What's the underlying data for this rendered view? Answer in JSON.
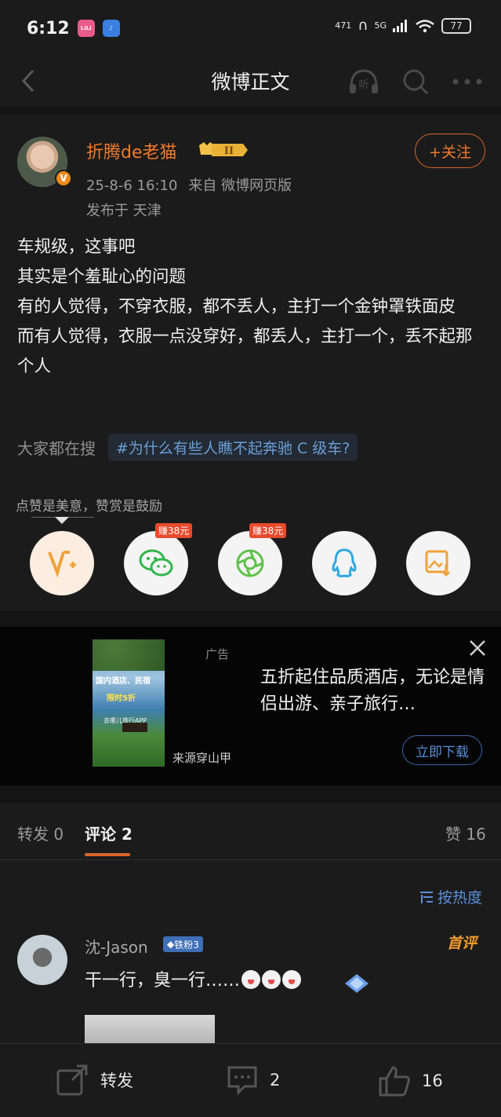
{
  "status_bar": {
    "time": "6:12",
    "app1": "LiLi",
    "net_speed": "471",
    "signal": "5G",
    "battery": "77"
  },
  "nav": {
    "title": "微博正文",
    "listen_label": "听"
  },
  "post": {
    "author": "折腾de老猫",
    "rank": "II",
    "follow_label": "+关注",
    "date": "25-8-6 16:10",
    "source": "来自 微博网页版",
    "location": "发布于 天津",
    "lines": [
      "车规级，这事吧",
      "其实是个羞耻心的问题",
      "有的人觉得，不穿衣服，都不丢人，主打一个金钟罩铁面皮",
      "而有人觉得，衣服一点没穿好，都丢人，主打一个，丢不起那个人"
    ],
    "search_label": "大家都在搜",
    "search_tag": "#为什么有些人瞧不起奔驰 C 级车?",
    "reward_caption": "点赞是美意，赞赏是鼓励",
    "earn_badge": "赚38元"
  },
  "ad": {
    "label": "广告",
    "image_title": "国内酒店、民宿",
    "image_subtitle": "限时5折",
    "image_caption": "去哪儿旅行APP",
    "text": "五折起住品质酒店，无论是情侣出游、亲子旅行…",
    "source": "来源穿山甲",
    "download_label": "立即下载"
  },
  "tabs": {
    "repost": "转发 0",
    "comment": "评论 2",
    "like": "赞 16"
  },
  "sort_label": "按热度",
  "comment": {
    "name": "沈-Jason",
    "fan_badge": "铁粉3",
    "first_badge": "首评",
    "text": "干一行，臭一行……"
  },
  "bottom": {
    "repost_label": "转发",
    "comment_count": "2",
    "like_count": "16"
  },
  "colors": {
    "accent_orange": "#f07a2c",
    "link_blue": "#5a8fd8",
    "background": "#1b1b1b"
  }
}
